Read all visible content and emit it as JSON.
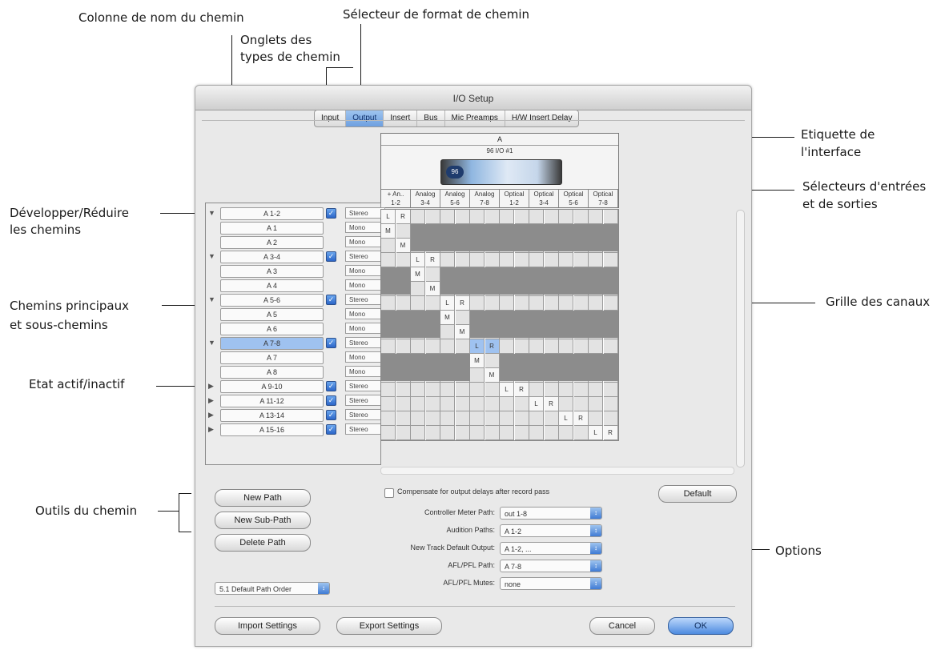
{
  "annotations": {
    "path_name_column": "Colonne de nom du chemin",
    "path_type_tabs": [
      "Onglets des",
      "types de chemin"
    ],
    "path_format_selector": "Sélecteur de format de chemin",
    "interface_label": [
      "Etiquette de",
      "l'interface"
    ],
    "io_selectors": [
      "Sélecteurs d'entrées",
      "et de sorties"
    ],
    "expand_collapse": [
      "Développer/Réduire",
      "les chemins"
    ],
    "main_subpaths": [
      "Chemins principaux",
      "et sous-chemins"
    ],
    "channel_grid": "Grille des canaux",
    "active_state": "Etat actif/inactif",
    "path_tools": "Outils du chemin",
    "options": "Options"
  },
  "window": {
    "title": "I/O Setup"
  },
  "tabs": [
    {
      "label": "Input",
      "active": false
    },
    {
      "label": "Output",
      "active": true
    },
    {
      "label": "Insert",
      "active": false
    },
    {
      "label": "Bus",
      "active": false
    },
    {
      "label": "Mic Preamps",
      "active": false
    },
    {
      "label": "H/W Insert Delay",
      "active": false
    }
  ],
  "interface": {
    "label": "A",
    "device": "96 I/O #1",
    "badge": "96",
    "channel_groups": [
      {
        "name": "+ An..",
        "range": "1-2"
      },
      {
        "name": "Analog",
        "range": "3-4"
      },
      {
        "name": "Analog",
        "range": "5-6"
      },
      {
        "name": "Analog",
        "range": "7-8"
      },
      {
        "name": "Optical",
        "range": "1-2"
      },
      {
        "name": "Optical",
        "range": "3-4"
      },
      {
        "name": "Optical",
        "range": "5-6"
      },
      {
        "name": "Optical",
        "range": "7-8"
      }
    ]
  },
  "paths": [
    {
      "name": "A 1-2",
      "format": "Stereo",
      "main": true,
      "expanded": true,
      "selected": false
    },
    {
      "name": "A 1",
      "format": "Mono",
      "main": false
    },
    {
      "name": "A 2",
      "format": "Mono",
      "main": false
    },
    {
      "name": "A 3-4",
      "format": "Stereo",
      "main": true,
      "expanded": true,
      "selected": false
    },
    {
      "name": "A 3",
      "format": "Mono",
      "main": false
    },
    {
      "name": "A 4",
      "format": "Mono",
      "main": false
    },
    {
      "name": "A 5-6",
      "format": "Stereo",
      "main": true,
      "expanded": true,
      "selected": false
    },
    {
      "name": "A 5",
      "format": "Mono",
      "main": false
    },
    {
      "name": "A 6",
      "format": "Mono",
      "main": false
    },
    {
      "name": "A 7-8",
      "format": "Stereo",
      "main": true,
      "expanded": true,
      "selected": true
    },
    {
      "name": "A 7",
      "format": "Mono",
      "main": false
    },
    {
      "name": "A 8",
      "format": "Mono",
      "main": false
    },
    {
      "name": "A 9-10",
      "format": "Stereo",
      "main": true,
      "expanded": false,
      "selected": false
    },
    {
      "name": "A 11-12",
      "format": "Stereo",
      "main": true,
      "expanded": false,
      "selected": false
    },
    {
      "name": "A 13-14",
      "format": "Stereo",
      "main": true,
      "expanded": false,
      "selected": false
    },
    {
      "name": "A 15-16",
      "format": "Stereo",
      "main": true,
      "expanded": false,
      "selected": false
    }
  ],
  "grid_labels": {
    "left": "L",
    "right": "R",
    "mono": "M"
  },
  "buttons": {
    "new_path": "New Path",
    "new_sub_path": "New Sub-Path",
    "delete_path": "Delete Path",
    "default": "Default",
    "import_settings": "Import Settings",
    "export_settings": "Export Settings",
    "cancel": "Cancel",
    "ok": "OK"
  },
  "path_order": "5.1 Default Path Order",
  "compensate_label": "Compensate for output delays after record pass",
  "options": [
    {
      "label": "Controller Meter Path:",
      "value": "out 1-8"
    },
    {
      "label": "Audition Paths:",
      "value": "A 1-2"
    },
    {
      "label": "New Track Default Output:",
      "value": "A 1-2, ..."
    },
    {
      "label": "AFL/PFL Path:",
      "value": "A 7-8"
    },
    {
      "label": "AFL/PFL Mutes:",
      "value": "none"
    }
  ]
}
